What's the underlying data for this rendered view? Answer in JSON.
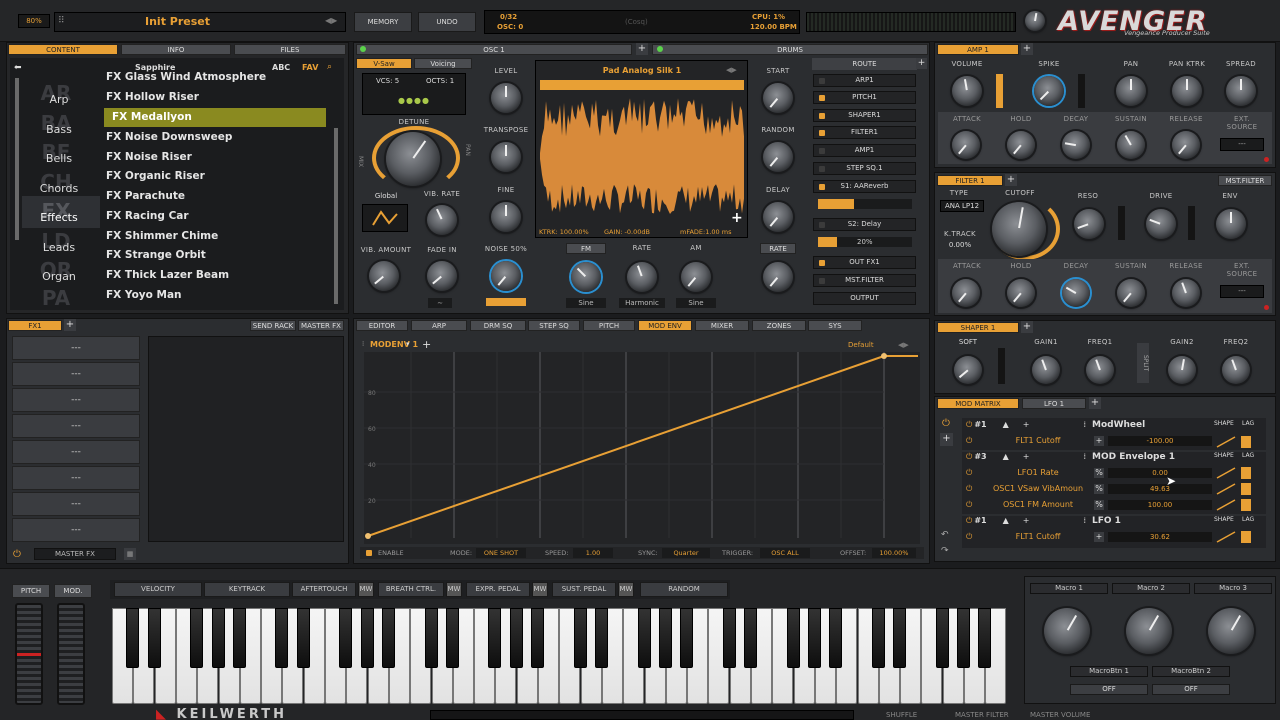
{
  "header": {
    "zoom": "80%",
    "preset_name": "Init Preset",
    "memory_label": "MEMORY",
    "undo_label": "UNDO",
    "voices": "0/32",
    "osc": "OSC: 0",
    "center_text": "(Cosq)",
    "cpu": "CPU:  1%",
    "bpm": "120.00 BPM",
    "logo": "AVENGER",
    "logo_sub": "Vengeance Producer Suite"
  },
  "browser": {
    "tabs": [
      "CONTENT",
      "INFO",
      "FILES"
    ],
    "bank": "Sapphire",
    "abc": "ABC",
    "fav": "FAV",
    "categories": [
      {
        "abbr": "AR",
        "label": "Arp"
      },
      {
        "abbr": "BA",
        "label": "Bass"
      },
      {
        "abbr": "BE",
        "label": "Bells"
      },
      {
        "abbr": "CH",
        "label": "Chords"
      },
      {
        "abbr": "FX",
        "label": "Effects"
      },
      {
        "abbr": "LD",
        "label": "Leads"
      },
      {
        "abbr": "OR",
        "label": "Organ"
      },
      {
        "abbr": "PA",
        "label": ""
      }
    ],
    "items": [
      "FX Glass Wind Atmosphere",
      "FX Hollow Riser",
      "FX Medallyon",
      "FX Noise Downsweep",
      "FX Noise Riser",
      "FX Organic Riser",
      "FX Parachute",
      "FX Racing Car",
      "FX Shimmer Chime",
      "FX Strange Orbit",
      "FX Thick Lazer Beam",
      "FX Yoyo Man"
    ]
  },
  "osc": {
    "tab1": "OSC 1",
    "tab2": "DRUMS",
    "mode_tabs": [
      "V-Saw",
      "Voicing"
    ],
    "vcs": "VCS: 5",
    "octs": "OCTS: 1",
    "detune": "DETUNE",
    "mix": "MIX",
    "pan": "PAN",
    "global": "Global",
    "vib_rate": "VIB. RATE",
    "vib_amount": "VIB. AMOUNT",
    "fade_in": "FADE IN",
    "level": "LEVEL",
    "transpose": "TRANSPOSE",
    "fine": "FINE",
    "noise": "NOISE 50%",
    "wave_name": "Pad Analog Silk 1",
    "ktrk": "KTRK: 100.00%",
    "gain": "GAIN: -0.00dB",
    "mfade": "mFADE:1.00 ms",
    "start": "START",
    "random": "RANDOM",
    "delay": "DELAY",
    "rate": "RATE",
    "fm": "FM",
    "fm_rate": "RATE",
    "am": "AM",
    "sine1": "Sine",
    "harmonic": "Harmonic",
    "sine2": "Sine"
  },
  "route": {
    "header": "ROUTE",
    "items": [
      "ARP1",
      "PITCH1",
      "SHAPER1",
      "FILTER1",
      "AMP1",
      "STEP SQ.1",
      "S1: AAReverb",
      "S2: Delay",
      "OUT FX1",
      "MST.FILTER",
      "OUTPUT"
    ],
    "s2_value": "20%"
  },
  "amp": {
    "tab": "AMP 1",
    "labels": [
      "VOLUME",
      "SPIKE",
      "PAN",
      "PAN KTRK",
      "SPREAD"
    ],
    "env": [
      "ATTACK",
      "HOLD",
      "DECAY",
      "SUSTAIN",
      "RELEASE",
      "EXT. SOURCE"
    ],
    "ext": "---"
  },
  "filter": {
    "tab": "FILTER 1",
    "mst": "MST.FILTER",
    "type_label": "TYPE",
    "type": "ANA LP12",
    "cutoff": "CUTOFF",
    "reso": "RESO",
    "drive": "DRIVE",
    "env": "ENV",
    "ktrack_label": "K.TRACK",
    "ktrack": "0.00%",
    "envs": [
      "ATTACK",
      "HOLD",
      "DECAY",
      "SUSTAIN",
      "RELEASE",
      "EXT. SOURCE"
    ],
    "ext": "---"
  },
  "shaper": {
    "tab": "SHAPER 1",
    "soft": "SOFT",
    "labels": [
      "GAIN1",
      "FREQ1",
      "GAIN2",
      "FREQ2"
    ],
    "split": "SPLIT"
  },
  "modmatrix": {
    "tab1": "MOD MATRIX",
    "tab2": "LFO 1",
    "shape": "SHAPE",
    "lag": "LAG",
    "groups": [
      {
        "id": "#1",
        "source": "ModWheel",
        "targets": [
          {
            "name": "FLT1 Cutoff",
            "value": "-100.00"
          }
        ]
      },
      {
        "id": "#3",
        "source": "MOD Envelope 1",
        "targets": [
          {
            "name": "LFO1 Rate",
            "value": "0.00"
          },
          {
            "name": "OSC1 VSaw VibAmoun",
            "value": "49.63"
          },
          {
            "name": "OSC1 FM Amount",
            "value": "100.00"
          }
        ]
      },
      {
        "id": "#1",
        "source": "LFO 1",
        "targets": [
          {
            "name": "FLT1 Cutoff",
            "value": "30.62"
          }
        ]
      }
    ]
  },
  "fx": {
    "tab": "FX1",
    "send_rack": "SEND RACK",
    "master_fx": "MASTER FX",
    "slots": [
      "---",
      "---",
      "---",
      "---",
      "---",
      "---",
      "---",
      "---"
    ],
    "footer": "MASTER FX"
  },
  "editor_tabs": [
    "EDITOR",
    "ARP",
    "DRM SQ",
    "STEP SQ",
    "PITCH",
    "MOD ENV",
    "MIXER",
    "ZONES",
    "SYS"
  ],
  "modenv": {
    "name": "MODENV 1",
    "preset": "Default",
    "y_ticks": [
      "80",
      "60",
      "40",
      "20"
    ],
    "enable": "ENABLE",
    "mode_label": "MODE:",
    "mode": "ONE SHOT",
    "speed_label": "SPEED:",
    "speed": "1.00",
    "sync_label": "SYNC:",
    "sync": "Quarter",
    "trigger_label": "TRIGGER:",
    "trigger": "OSC ALL",
    "offset_label": "OFFSET:",
    "offset": "100.00%",
    "chart_data": {
      "type": "line",
      "x": [
        0,
        12
      ],
      "y": [
        0,
        100
      ],
      "ylim": [
        0,
        100
      ]
    }
  },
  "keyboard": {
    "pitch": "PITCH",
    "mod": "MOD.",
    "buttons": [
      "VELOCITY",
      "KEYTRACK",
      "AFTERTOUCH",
      "BREATH CTRL.",
      "EXPR. PEDAL",
      "SUST. PEDAL",
      "RANDOM"
    ],
    "mw": "MW"
  },
  "macros": {
    "labels": [
      "Macro 1",
      "Macro 2",
      "Macro 3"
    ],
    "btns": [
      "MacroBtn 1",
      "MacroBtn 2"
    ],
    "off": "OFF"
  },
  "footer": {
    "brand": "KEILWERTH",
    "shuffle": "SHUFFLE",
    "master_filter": "MASTER FILTER",
    "master_volume": "MASTER VOLUME"
  }
}
